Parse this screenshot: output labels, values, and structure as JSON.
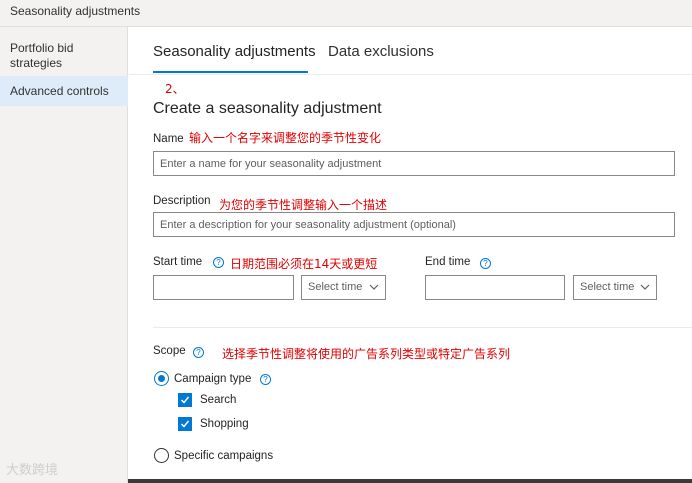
{
  "window": {
    "title": "Seasonality adjustments"
  },
  "sidebar": {
    "items": [
      {
        "label": "Portfolio bid strategies"
      },
      {
        "label": "Advanced controls"
      }
    ]
  },
  "tabs": [
    {
      "label": "Seasonality adjustments",
      "active": true
    },
    {
      "label": "Data exclusions",
      "active": false
    }
  ],
  "annotations": {
    "step": "2、",
    "name": "输入一个名字来调整您的季节性变化",
    "description": "为您的季节性调整输入一个描述",
    "date_range": "日期范围必须在14天或更短",
    "scope": "选择季节性调整将使用的广告系列类型或特定广告系列"
  },
  "form": {
    "heading": "Create a seasonality adjustment",
    "name": {
      "label": "Name",
      "placeholder": "Enter a name for your seasonality adjustment",
      "value": ""
    },
    "description": {
      "label": "Description",
      "placeholder": "Enter a description for your seasonality adjustment (optional)",
      "value": ""
    },
    "start_time": {
      "label": "Start time",
      "date_value": "",
      "time_select": "Select time"
    },
    "end_time": {
      "label": "End time",
      "date_value": "",
      "time_select": "Select time"
    },
    "scope": {
      "label": "Scope",
      "options": [
        {
          "label": "Campaign type",
          "selected": true
        },
        {
          "label": "Specific campaigns",
          "selected": false
        }
      ],
      "campaign_types": [
        {
          "label": "Search",
          "checked": true
        },
        {
          "label": "Shopping",
          "checked": true
        }
      ]
    }
  },
  "watermark": "大数跨境",
  "icons": {
    "help": "help-circle-icon",
    "chevron": "chevron-down-icon",
    "check": "checkmark-icon"
  },
  "colors": {
    "accent": "#0078d4",
    "annotation": "#e00000"
  }
}
